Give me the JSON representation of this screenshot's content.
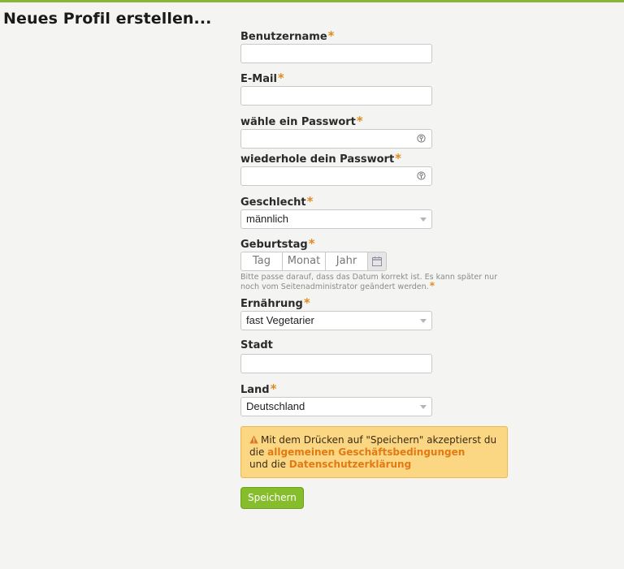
{
  "page": {
    "title": "Neues Profil erstellen..."
  },
  "required_marker": "*",
  "colors": {
    "accent_green": "#86bd2c",
    "required_orange": "#e28a1e",
    "notice_bg": "#fcd783",
    "link_orange": "#e27a14"
  },
  "fields": {
    "username": {
      "label": "Benutzername",
      "value": ""
    },
    "email": {
      "label": "E-Mail",
      "value": ""
    },
    "password": {
      "label": "wähle ein Passwort",
      "value": "",
      "icon": "key-icon"
    },
    "password_repeat": {
      "label": "wiederhole dein Passwort",
      "value": "",
      "icon": "key-icon"
    },
    "gender": {
      "label": "Geschlecht",
      "selected": "männlich"
    },
    "birthday": {
      "label": "Geburtstag",
      "day_placeholder": "Tag",
      "month_placeholder": "Monat",
      "year_placeholder": "Jahr",
      "icon": "calendar-icon",
      "hint": "Bitte passe darauf, dass das Datum korrekt ist. Es kann später nur noch vom Seitenadministrator geändert werden."
    },
    "diet": {
      "label": "Ernährung",
      "selected": "fast Vegetarier"
    },
    "city": {
      "label": "Stadt",
      "value": ""
    },
    "country": {
      "label": "Land",
      "selected": "Deutschland"
    }
  },
  "notice": {
    "icon": "warning-icon",
    "text_before": "Mit dem Drücken auf \"Speichern\" akzeptierst du die ",
    "link_terms": "allgemeinen Geschäftsbedingungen",
    "text_middle": " und die ",
    "link_privacy": "Datenschutzerklärung"
  },
  "actions": {
    "save_label": "Speichern"
  }
}
